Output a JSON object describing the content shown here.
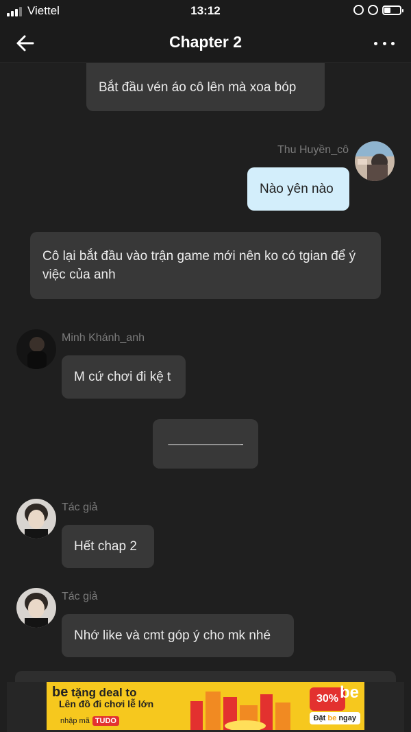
{
  "status_bar": {
    "carrier": "Viettel",
    "time": "13:12"
  },
  "header": {
    "title": "Chapter 2"
  },
  "messages": [
    {
      "text": "Bắt đầu vén áo cô lên mà xoa bóp"
    },
    {
      "author": "Thu Huyền_cô",
      "text": "Nào yên nào"
    },
    {
      "text": "Cô lại bắt đầu vào trận game mới nên ko có tgian để ý việc của anh"
    },
    {
      "author": "Minh Khánh_anh",
      "text": "M cứ chơi đi kệ t"
    },
    {
      "text": "———————-"
    },
    {
      "author": "Tác giả",
      "text": "Hết chap 2"
    },
    {
      "author": "Tác giả",
      "text": "Nhớ like và cmt góp ý cho mk nhé"
    }
  ],
  "ad": {
    "brand": "be",
    "line1": "tặng deal to",
    "line2": "Lên đồ đi chơi lễ lớn",
    "code_prefix": "nhập mã",
    "code": "TUDO",
    "discount": "30%",
    "cta_prefix": "Đặt",
    "cta_brand": "be",
    "cta_suffix": "ngay"
  },
  "colors": {
    "background": "#1f1f1f",
    "bubble": "#383838",
    "my_bubble": "#d3eefb",
    "ad_yellow": "#f6c81e"
  }
}
